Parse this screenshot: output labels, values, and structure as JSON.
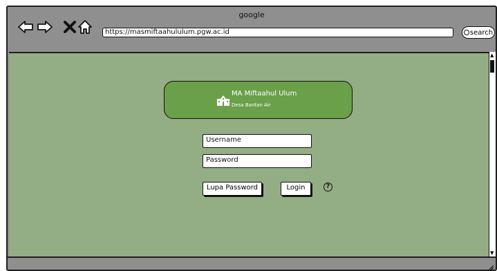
{
  "browser": {
    "title": "google",
    "url": "https://masmiftaahululum.pgw.ac.id",
    "search_label": "search"
  },
  "header": {
    "school_name": "MA Miftaahul Ulum",
    "school_location": "Desa Bantan Air"
  },
  "login_form": {
    "username_placeholder": "Username",
    "password_placeholder": "Password",
    "forgot_label": "Lupa Password",
    "login_label": "Login",
    "help_label": "?"
  },
  "colors": {
    "content_bg": "#93ad84",
    "header_bg": "#6aa04a",
    "chrome": "#8f8f8f"
  },
  "icons": [
    "back-arrow-icon",
    "forward-arrow-icon",
    "stop-icon",
    "home-icon",
    "search-icon",
    "school-icon",
    "help-icon",
    "resize-grip-icon"
  ]
}
